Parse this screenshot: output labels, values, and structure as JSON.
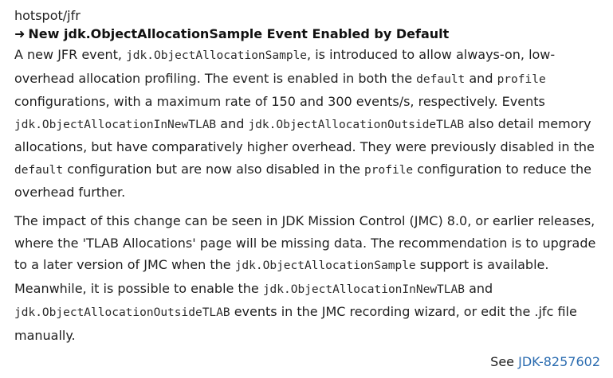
{
  "component": "hotspot/jfr",
  "title": {
    "arrow": "➜",
    "text": "New jdk.ObjectAllocationSample Event Enabled by Default"
  },
  "paragraph1": {
    "t1": "A new JFR event, ",
    "c1": "jdk.ObjectAllocationSample",
    "t2": ", is introduced to allow always-on, low-overhead allocation profiling. The event is enabled in both the ",
    "c2": "default",
    "t3": " and ",
    "c3": "profile",
    "t4": " configurations, with a maximum rate of 150 and 300 events/s, respectively. Events ",
    "c4": "jdk.ObjectAllocationInNewTLAB",
    "t5": " and ",
    "c5": "jdk.ObjectAllocationOutsideTLAB",
    "t6": " also detail memory allocations, but have comparatively higher overhead. They were previously disabled in the ",
    "c6": "default",
    "t7": " configuration but are now also disabled in the ",
    "c7": "profile",
    "t8": " configuration to reduce the overhead further."
  },
  "paragraph2": {
    "t1": "The impact of this change can be seen in JDK Mission Control (JMC) 8.0, or earlier releases, where the 'TLAB Allocations' page will be missing data. The recommendation is to upgrade to a later version of JMC when the ",
    "c1": "jdk.ObjectAllocationSample",
    "t2": " support is available. Meanwhile, it is possible to enable the ",
    "c2": "jdk.ObjectAllocationInNewTLAB",
    "t3": " and ",
    "c3": "jdk.ObjectAllocationOutsideTLAB",
    "t4": " events in the JMC recording wizard, or edit the .jfc file manually."
  },
  "see_also": {
    "prefix": "See ",
    "link_text": "JDK-8257602"
  }
}
